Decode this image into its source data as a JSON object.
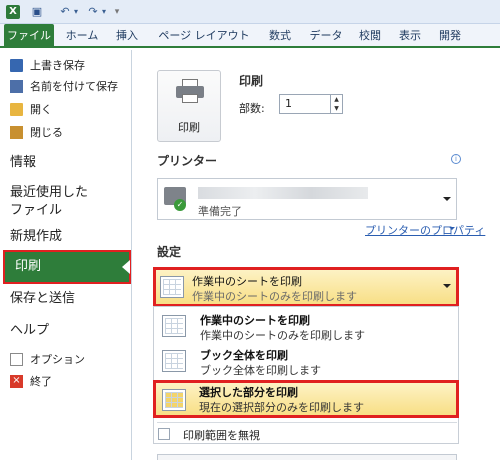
{
  "qat": {
    "app_icon": "excel-icon",
    "save_icon": "floppy-disk-icon",
    "undo_icon": "undo-icon",
    "redo_icon": "redo-icon",
    "customize_icon": "customize-qat-icon"
  },
  "ribbon": {
    "tabs": [
      "ファイル",
      "ホーム",
      "挿入",
      "ページ レイアウト",
      "数式",
      "データ",
      "校閲",
      "表示",
      "開発"
    ],
    "active_tab_color": "#2e7d3a"
  },
  "nav": {
    "small_items": [
      {
        "label": "上書き保存",
        "icon": "save-icon"
      },
      {
        "label": "名前を付けて保存",
        "icon": "save-as-icon"
      },
      {
        "label": "開く",
        "icon": "open-folder-icon"
      },
      {
        "label": "閉じる",
        "icon": "close-folder-icon"
      }
    ],
    "info": "情報",
    "recent_line1": "最近使用した",
    "recent_line2": "ファイル",
    "new": "新規作成",
    "print": "印刷",
    "save_send": "保存と送信",
    "help": "ヘルプ",
    "options": "オプション",
    "exit": "終了"
  },
  "print_section": {
    "title": "印刷",
    "button_label": "印刷",
    "copies_label": "部数:",
    "copies_value": "1"
  },
  "printer_section": {
    "title": "プリンター",
    "status": "準備完了",
    "properties_link": "プリンターのプロパティ"
  },
  "settings": {
    "title": "設定",
    "selected": {
      "title": "作業中のシートを印刷",
      "desc": "作業中のシートのみを印刷します"
    },
    "options": [
      {
        "title": "作業中のシートを印刷",
        "desc": "作業中のシートのみを印刷します"
      },
      {
        "title": "ブック全体を印刷",
        "desc": "ブック全体を印刷します"
      },
      {
        "title": "選択した部分を印刷",
        "desc": "現在の選択部分のみを印刷します"
      }
    ],
    "ignore_print_area": "印刷範囲を無視",
    "highlight_color": "#e02020"
  }
}
